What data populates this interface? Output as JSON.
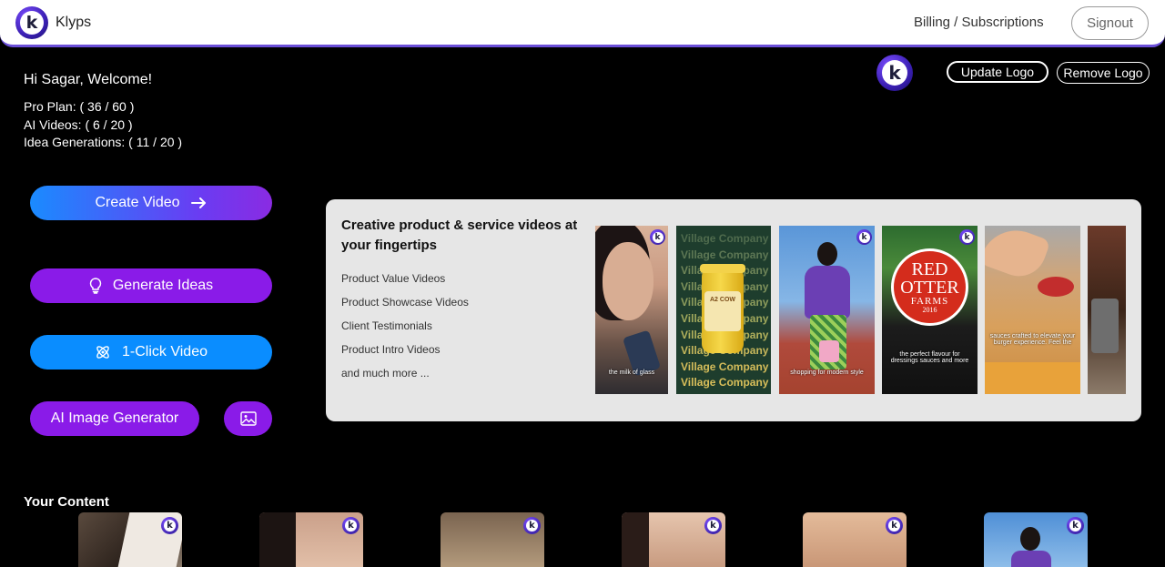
{
  "header": {
    "brand": "Klyps",
    "logo_letter": "k",
    "billing_label": "Billing / Subscriptions",
    "signout_label": "Signout"
  },
  "welcome": {
    "greeting": "Hi Sagar, Welcome!",
    "pro_plan": "Pro Plan: ( 36 / 60 )",
    "ai_videos": "AI Videos: ( 6 / 20 )",
    "idea_generations": "Idea Generations: ( 11 / 20 )"
  },
  "logo_controls": {
    "update_label": "Update Logo",
    "remove_label": "Remove Logo"
  },
  "actions": {
    "create_video": "Create Video",
    "generate_ideas": "Generate Ideas",
    "one_click_video": "1-Click Video",
    "ai_image_generator": "AI Image Generator"
  },
  "showcase": {
    "title": "Creative product & service videos at your fingertips",
    "items": [
      "Product Value Videos",
      "Product Showcase Videos",
      "Client Testimonials",
      "Product Intro Videos",
      "and much more ..."
    ],
    "village_company_text": "Village Company",
    "jar_label": "A2 COW",
    "captions": {
      "thumb1": "the milk of glass",
      "thumb3": "shopping for modern style",
      "thumb4": "the perfect flavour for dressings sauces and more",
      "thumb5": "sauces crafted to elevate your burger experience. Feel the"
    },
    "red_otter": {
      "line1": "RED",
      "line2": "OTTER",
      "line3": "FARMS",
      "year": "2016"
    }
  },
  "content": {
    "title": "Your Content"
  },
  "colors": {
    "accent_purple": "#8a1be8",
    "accent_blue": "#0a8dff",
    "header_border": "#6b4fd8"
  }
}
